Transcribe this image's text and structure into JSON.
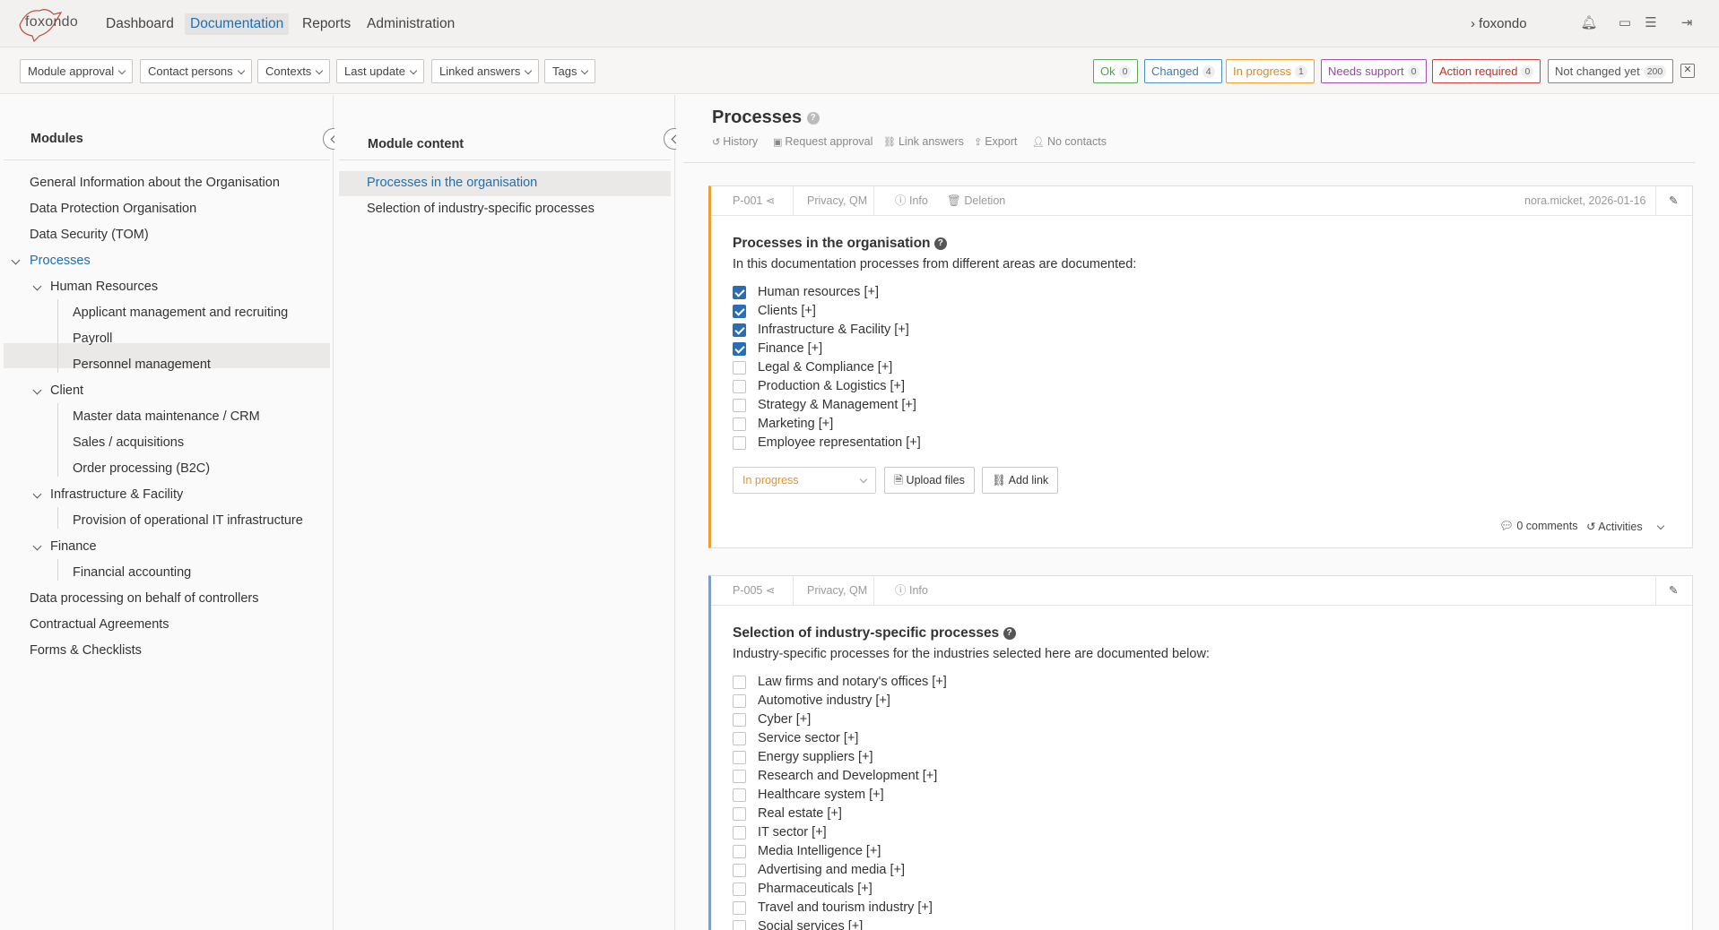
{
  "app": {
    "logo_text": "foxondo"
  },
  "nav": {
    "items": [
      "Dashboard",
      "Documentation",
      "Reports",
      "Administration"
    ],
    "user": "foxondo"
  },
  "filters": [
    "Module approval",
    "Contact persons",
    "Contexts",
    "Last update",
    "Linked answers",
    "Tags"
  ],
  "statuses": [
    {
      "label": "Ok",
      "count": "0",
      "color": "#5aaa5a"
    },
    {
      "label": "Changed",
      "count": "4",
      "color": "#4a90c8"
    },
    {
      "label": "In progress",
      "count": "1",
      "color": "#f0a030"
    },
    {
      "label": "Needs support",
      "count": "0",
      "color": "#a050b0"
    },
    {
      "label": "Action required",
      "count": "0",
      "color": "#d04040"
    },
    {
      "label": "Not changed yet",
      "count": "200",
      "color": "#888888"
    }
  ],
  "modules": {
    "title": "Modules",
    "items": [
      "General Information about the Organisation",
      "Data Protection Organisation",
      "Data Security (TOM)",
      "Processes",
      "Human Resources",
      "Applicant management and recruiting",
      "Payroll",
      "Personnel management",
      "Client",
      "Master data maintenance / CRM",
      "Sales / acquisitions",
      "Order processing (B2C)",
      "Infrastructure & Facility",
      "Provision of operational IT infrastructure",
      "Finance",
      "Financial accounting",
      "Data processing on behalf of controllers",
      "Contractual Agreements",
      "Forms & Checklists"
    ]
  },
  "content": {
    "title": "Module content",
    "items": [
      "Processes in the organisation",
      "Selection of industry-specific processes"
    ]
  },
  "main": {
    "title": "Processes",
    "actions": [
      "History",
      "Request approval",
      "Link answers",
      "Export",
      "No contacts"
    ]
  },
  "card1": {
    "id": "P-001",
    "tags": "Privacy, QM",
    "info": "Info",
    "deletion": "Deletion",
    "meta": "nora.micket, 2026-01-16",
    "title": "Processes in the organisation",
    "desc": "In this documentation processes from different areas are documented:",
    "options": [
      {
        "label": "Human resources [+]",
        "checked": true
      },
      {
        "label": "Clients [+]",
        "checked": true
      },
      {
        "label": "Infrastructure & Facility [+]",
        "checked": true
      },
      {
        "label": "Finance [+]",
        "checked": true
      },
      {
        "label": "Legal & Compliance [+]",
        "checked": false
      },
      {
        "label": "Production & Logistics [+]",
        "checked": false
      },
      {
        "label": "Strategy & Management [+]",
        "checked": false
      },
      {
        "label": "Marketing [+]",
        "checked": false
      },
      {
        "label": "Employee representation [+]",
        "checked": false
      }
    ],
    "status": "In progress",
    "upload": "Upload files",
    "add_link": "Add link",
    "comments": "0 comments",
    "activities": "Activities"
  },
  "card2": {
    "id": "P-005",
    "tags": "Privacy, QM",
    "info": "Info",
    "title": "Selection of industry-specific processes",
    "desc": "Industry-specific processes for the industries selected here are documented below:",
    "options": [
      {
        "label": "Law firms and notary's offices [+]",
        "checked": false
      },
      {
        "label": "Automotive industry [+]",
        "checked": false
      },
      {
        "label": "Cyber [+]",
        "checked": false
      },
      {
        "label": "Service sector [+]",
        "checked": false
      },
      {
        "label": "Energy suppliers [+]",
        "checked": false
      },
      {
        "label": "Research and Development [+]",
        "checked": false
      },
      {
        "label": "Healthcare system [+]",
        "checked": false
      },
      {
        "label": "Real estate [+]",
        "checked": false
      },
      {
        "label": "IT sector [+]",
        "checked": false
      },
      {
        "label": "Media Intelligence [+]",
        "checked": false
      },
      {
        "label": "Advertising and media [+]",
        "checked": false
      },
      {
        "label": "Pharmaceuticals [+]",
        "checked": false
      },
      {
        "label": "Travel and tourism industry [+]",
        "checked": false
      },
      {
        "label": "Social services [+]",
        "checked": false
      }
    ]
  }
}
